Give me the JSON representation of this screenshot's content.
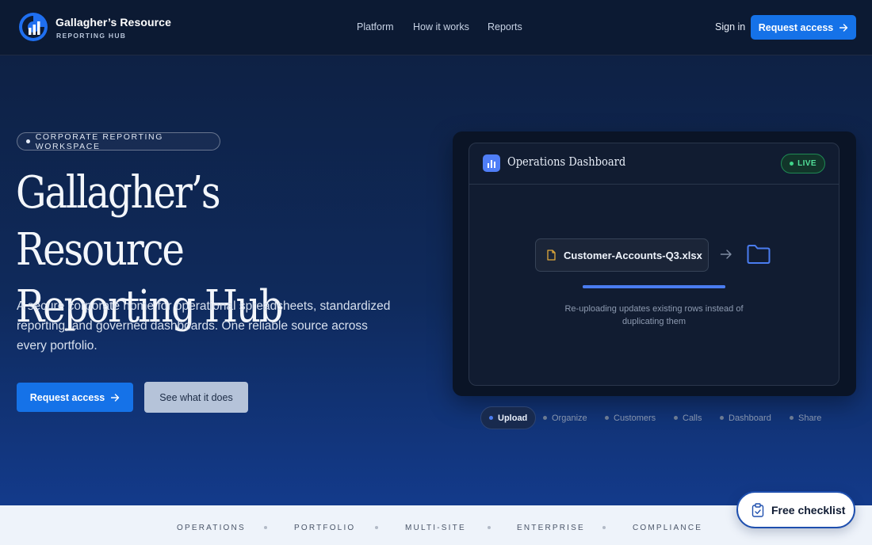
{
  "nav": {
    "brand_name": "Gallagher’s Resource",
    "brand_sub": "REPORTING HUB",
    "links": [
      "Platform",
      "How it works",
      "Reports"
    ],
    "sign_in": "Sign in",
    "cta": "Request access"
  },
  "hero": {
    "eyebrow": "CORPORATE REPORTING WORKSPACE",
    "title_line1": "Gallagher’s Resource",
    "title_line2": "Reporting Hub",
    "description": "A secure corporate home for operational spreadsheets, standardized reporting, and governed dashboards. One reliable source across every portfolio.",
    "primary_cta": "Request access",
    "secondary_cta": "See what it does"
  },
  "dashboard": {
    "title": "Operations Dashboard",
    "badge": "LIVE",
    "file_name": "Customer-Accounts-Q3.xlsx",
    "progress": 1.0,
    "status": "Re-uploading updates existing rows instead of duplicating them"
  },
  "steps": [
    "Upload",
    "Organize",
    "Customers",
    "Calls",
    "Dashboard",
    "Share"
  ],
  "active_step": "Upload",
  "strip": [
    "OPERATIONS",
    "PORTFOLIO",
    "MULTI-SITE",
    "ENTERPRISE",
    "COMPLIANCE"
  ],
  "checklist": "Free checklist",
  "colors": {
    "accent": "#1572e8",
    "live": "#52e09a",
    "folder": "#4a7cf0"
  }
}
